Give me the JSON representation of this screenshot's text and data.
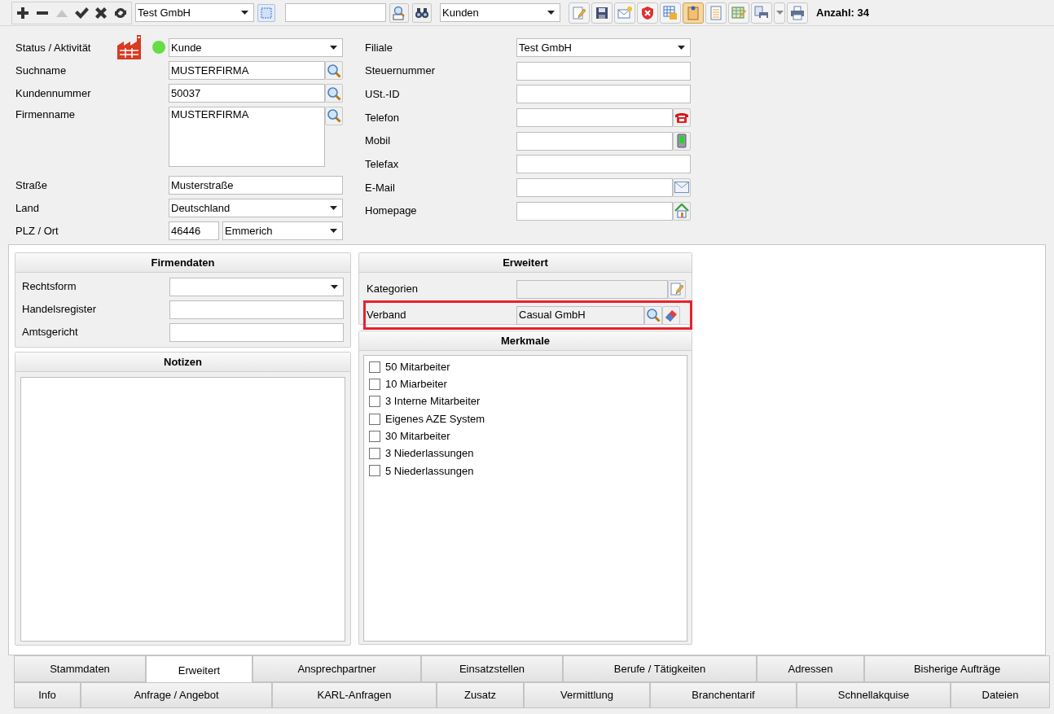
{
  "toolbar": {
    "nav_buttons": [
      {
        "kind": "add",
        "disabled": false
      },
      {
        "kind": "remove",
        "disabled": false
      },
      {
        "kind": "up",
        "disabled": true
      },
      {
        "kind": "accept",
        "disabled": false
      },
      {
        "kind": "cancel",
        "disabled": false
      },
      {
        "kind": "refresh",
        "disabled": false
      }
    ],
    "branch_select": {
      "value": "Test GmbH"
    },
    "category_select": {
      "value": "Kunden"
    },
    "buttons": [
      {
        "kind": "edit",
        "pressed": false
      },
      {
        "kind": "save",
        "pressed": false
      },
      {
        "kind": "mail",
        "pressed": false
      },
      {
        "kind": "shield",
        "pressed": false
      },
      {
        "kind": "table",
        "pressed": false
      },
      {
        "kind": "note",
        "pressed": true
      },
      {
        "kind": "list",
        "pressed": false
      },
      {
        "kind": "chart",
        "pressed": false
      },
      {
        "kind": "print-copy",
        "pressed": false
      },
      {
        "kind": "dropdown",
        "pressed": false
      },
      {
        "kind": "print",
        "pressed": false
      }
    ],
    "count": "Anzahl: 34"
  },
  "form_left": [
    {
      "label": "Status / Aktivität",
      "kind": "status",
      "color": "#66dd44",
      "value": "Kunde"
    },
    {
      "label": "Suchname",
      "kind": "search",
      "value": "MUSTERFIRMA"
    },
    {
      "label": "Kundennummer",
      "kind": "search",
      "value": "50037"
    },
    {
      "label": "Firmenname",
      "kind": "memo-search",
      "value": "MUSTERFIRMA"
    },
    {
      "label": "Straße",
      "kind": "text",
      "value": "Musterstraße"
    },
    {
      "label": "Land",
      "kind": "select",
      "value": "Deutschland"
    },
    {
      "label": "PLZ / Ort",
      "kind": "plz",
      "value": "46446",
      "city": "Emmerich"
    }
  ],
  "form_right": [
    {
      "label": "Filiale",
      "kind": "select",
      "value": "Test GmbH"
    },
    {
      "label": "Steuernummer",
      "kind": "text"
    },
    {
      "label": "USt.-ID",
      "kind": "text"
    },
    {
      "label": "Telefon",
      "kind": "phone"
    },
    {
      "label": "Mobil",
      "kind": "mobile"
    },
    {
      "label": "Telefax",
      "kind": "text"
    },
    {
      "label": "E-Mail",
      "kind": "mail"
    },
    {
      "label": "Homepage",
      "kind": "home"
    }
  ],
  "firmendaten": {
    "title": "Firmendaten",
    "fields": [
      {
        "label": "Rechtsform",
        "kind": "select"
      },
      {
        "label": "Handelsregister",
        "kind": "text"
      },
      {
        "label": "Amtsgericht",
        "kind": "text"
      }
    ]
  },
  "notizen": {
    "title": "Notizen"
  },
  "erweitert": {
    "title": "Erweitert",
    "fields": [
      {
        "label": "Kategorien",
        "kind": "categories",
        "highlighted": false
      },
      {
        "label": "Verband",
        "kind": "association",
        "value": "Casual GmbH",
        "highlighted": true
      }
    ]
  },
  "merkmale": {
    "title": "Merkmale",
    "items": [
      {
        "label": "50 Mitarbeiter",
        "checked": false
      },
      {
        "label": "10 Miarbeiter",
        "checked": false
      },
      {
        "label": "3 Interne Mitarbeiter",
        "checked": false
      },
      {
        "label": "Eigenes AZE System",
        "checked": false
      },
      {
        "label": "30 Mitarbeiter",
        "checked": false
      },
      {
        "label": "3 Niederlassungen",
        "checked": false
      },
      {
        "label": "5 Niederlassungen",
        "checked": false
      }
    ]
  },
  "tabs_row_1": [
    {
      "label": "Stammdaten",
      "selected": false
    },
    {
      "label": "Erweitert",
      "selected": true
    },
    {
      "label": "Ansprechpartner",
      "selected": false
    },
    {
      "label": "Einsatzstellen",
      "selected": false
    },
    {
      "label": "Berufe / Tätigkeiten",
      "selected": false
    },
    {
      "label": "Adressen",
      "selected": false
    },
    {
      "label": "Bisherige Aufträge",
      "selected": false
    }
  ],
  "tabs_row_2": [
    {
      "label": "Info",
      "selected": false
    },
    {
      "label": "Anfrage / Angebot",
      "selected": false
    },
    {
      "label": "KARL-Anfragen",
      "selected": false
    },
    {
      "label": "Zusatz",
      "selected": false
    },
    {
      "label": "Vermittlung",
      "selected": false
    },
    {
      "label": "Branchentarif",
      "selected": false
    },
    {
      "label": "Schnellakquise",
      "selected": false
    },
    {
      "label": "Dateien",
      "selected": false
    }
  ]
}
